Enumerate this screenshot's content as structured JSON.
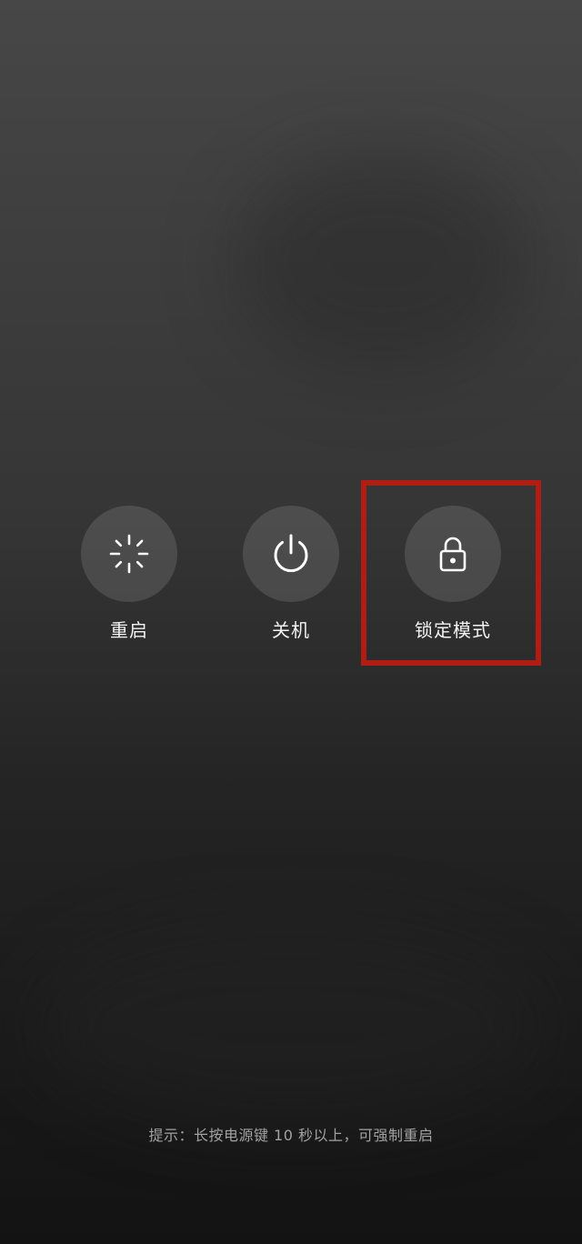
{
  "actions": {
    "restart": {
      "label": "重启",
      "icon": "restart-spinner-icon"
    },
    "power": {
      "label": "关机",
      "icon": "power-icon"
    },
    "lockdown": {
      "label": "锁定模式",
      "icon": "lock-icon"
    }
  },
  "highlight": {
    "target": "lockdown",
    "color": "#b21d13"
  },
  "hint": {
    "text": "提示：长按电源键 10 秒以上，可强制重启"
  },
  "colors": {
    "background_top": "#474747",
    "background_bottom": "#131313",
    "label_text": "#f2f2f2",
    "hint_text": "#a2a2a2"
  }
}
